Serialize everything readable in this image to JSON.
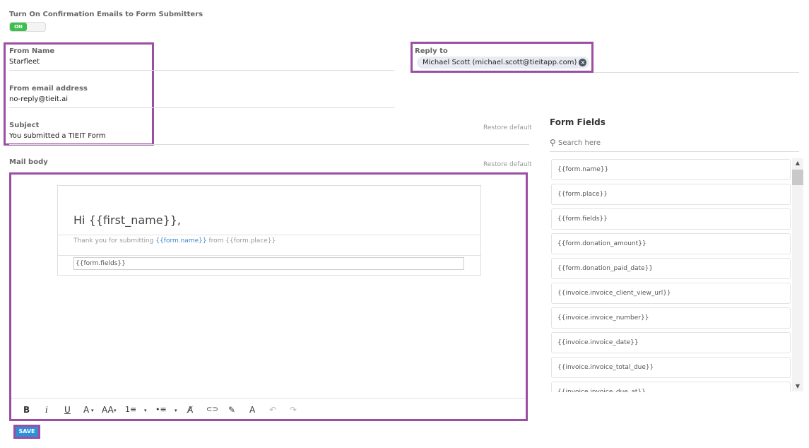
{
  "confirm": {
    "title": "Turn On Confirmation Emails to Form Submitters",
    "toggle_label": "ON"
  },
  "from_name": {
    "label": "From Name",
    "value": "Starfleet"
  },
  "from_email": {
    "label": "From email address",
    "value": "no-reply@tieit.ai"
  },
  "subject": {
    "label": "Subject",
    "value": "You submitted a TIEIT Form",
    "restore": "Restore default"
  },
  "reply_to": {
    "label": "Reply to",
    "chip": "Michael Scott (michael.scott@tieitapp.com)"
  },
  "mail_body": {
    "label": "Mail body",
    "restore": "Restore default",
    "greeting": "Hi {{first_name}},",
    "thanks_prefix": "Thank you for submitting ",
    "thanks_token": "{{form.name}}",
    "thanks_suffix": " from {{form.place}}",
    "fields_token": "{{form.fields}}"
  },
  "toolbar": {
    "bold": "B",
    "italic": "i",
    "underline": "U",
    "font_color": "A",
    "font_size": "AA",
    "ordered_list": "1≡",
    "bullet_list": "•≡",
    "clear_format": "A̸",
    "link": "⊂⊃",
    "highlight": "✎",
    "fill": "A",
    "undo": "↶",
    "redo": "↷"
  },
  "form_fields": {
    "title": "Form Fields",
    "search_placeholder": "Search here",
    "items": [
      "{{form.name}}",
      "{{form.place}}",
      "{{form.fields}}",
      "{{form.donation_amount}}",
      "{{form.donation_paid_date}}",
      "{{invoice.invoice_client_view_url}}",
      "{{invoice.invoice_number}}",
      "{{invoice.invoice_date}}",
      "{{invoice.invoice_total_due}}",
      "{{invoice.invoice_due_at}}"
    ]
  },
  "save_label": "SAVE",
  "colors": {
    "highlight": "#9b4ea4",
    "toggle_on": "#3cbf4d",
    "save": "#2d8fd5",
    "link_token": "#3d87c8"
  }
}
